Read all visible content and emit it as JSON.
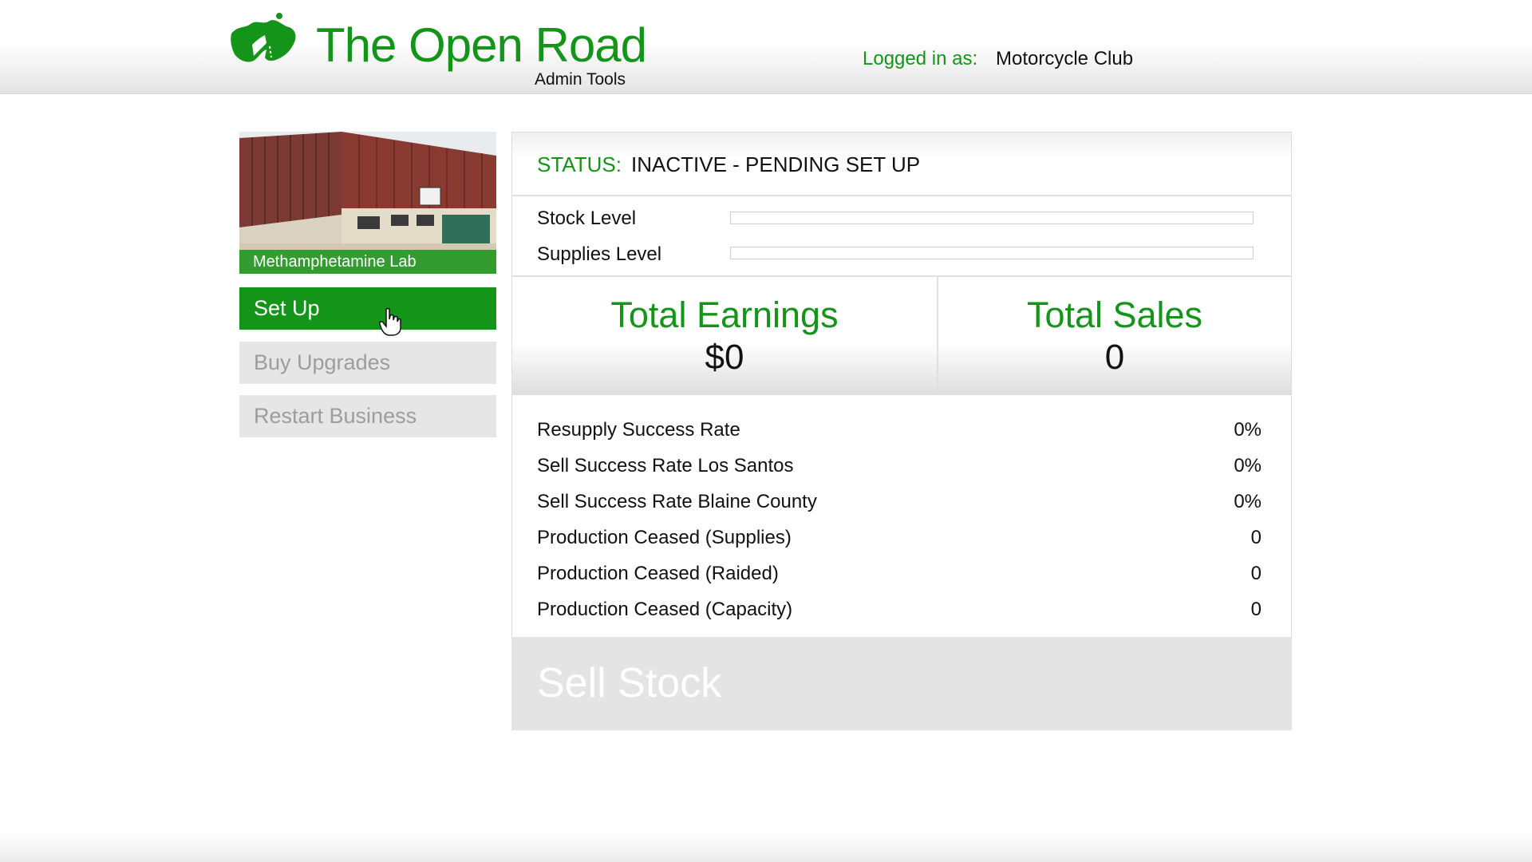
{
  "header": {
    "brand_title": "The Open Road",
    "brand_subtitle": "Admin Tools",
    "logged_in_label": "Logged in as:",
    "logged_in_user": "Motorcycle Club",
    "logo_icon": "road-logo-icon"
  },
  "sidebar": {
    "business_name": "Methamphetamine Lab",
    "buttons": [
      {
        "label": "Set Up",
        "state": "active"
      },
      {
        "label": "Buy Upgrades",
        "state": "disabled"
      },
      {
        "label": "Restart Business",
        "state": "disabled"
      }
    ]
  },
  "panel": {
    "status_label": "STATUS:",
    "status_value": "INACTIVE - PENDING SET UP",
    "levels": [
      {
        "label": "Stock Level",
        "fill_fraction": 0
      },
      {
        "label": "Supplies Level",
        "fill_fraction": 0
      }
    ],
    "totals": [
      {
        "title": "Total Earnings",
        "value": "$0"
      },
      {
        "title": "Total Sales",
        "value": "0"
      }
    ],
    "stats": [
      {
        "label": "Resupply Success Rate",
        "value": "0%"
      },
      {
        "label": "Sell Success Rate Los Santos",
        "value": "0%"
      },
      {
        "label": "Sell Success Rate Blaine County",
        "value": "0%"
      },
      {
        "label": "Production Ceased (Supplies)",
        "value": "0"
      },
      {
        "label": "Production Ceased (Raided)",
        "value": "0"
      },
      {
        "label": "Production Ceased (Capacity)",
        "value": "0"
      }
    ],
    "sell_button": "Sell Stock"
  },
  "colors": {
    "accent": "#15941a",
    "disabled_bg": "#e6e6e6",
    "disabled_text": "#9d9d9d"
  }
}
